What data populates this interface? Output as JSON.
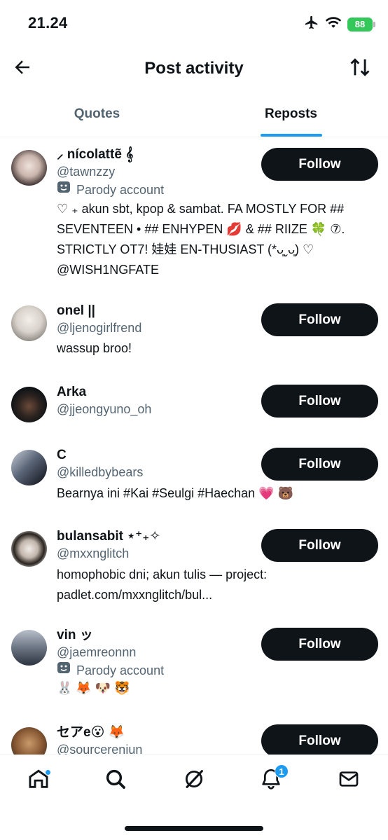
{
  "status_bar": {
    "time": "21.24",
    "battery": "88",
    "icons": [
      "airplane-icon",
      "wifi-icon",
      "battery-icon"
    ]
  },
  "header": {
    "title": "Post activity",
    "back_icon": "arrow-left-icon",
    "sort_icon": "sort-arrows-icon"
  },
  "tabs": [
    {
      "label": "Quotes",
      "active": false
    },
    {
      "label": "Reposts",
      "active": true
    }
  ],
  "users": [
    {
      "display_name": "⸝ nícolattẽ 𝄞",
      "handle": "@tawnzzy",
      "parody": "Parody account",
      "bio": "♡ ₊ akun sbt, kpop & sambat. FA MOSTLY FOR ## SEVENTEEN • ## ENHYPEN 💋 & ## RIIZE 🍀 ⑦. STRICTLY OT7! 娃娃 EN-THUSIAST (*ᴗ͈ˬᴗ͈) ♡ @WISH1NGFATE",
      "follow_label": "Follow"
    },
    {
      "display_name": "onel ||",
      "handle": "@ljenogirlfrend",
      "parody": "",
      "bio": "wassup broo!",
      "follow_label": "Follow"
    },
    {
      "display_name": "Arka",
      "handle": "@jjeongyuno_oh",
      "parody": "",
      "bio": "",
      "follow_label": "Follow"
    },
    {
      "display_name": "C",
      "handle": "@killedbybears",
      "parody": "",
      "bio": "Bearnya ini #Kai #Seulgi #Haechan 💗 🐻",
      "follow_label": "Follow"
    },
    {
      "display_name": "bulansabit ⋆⁺₊✧",
      "handle": "@mxxnglitch",
      "parody": "",
      "bio": "homophobic dni; akun tulis — project: padlet.com/mxxnglitch/bul...",
      "follow_label": "Follow"
    },
    {
      "display_name": "vin ッ",
      "handle": "@jaemreonnn",
      "parody": "Parody account",
      "bio": "🐰 🦊 🐶 🐯",
      "follow_label": "Follow"
    },
    {
      "display_name": "セアe😮 🦊",
      "handle": "@sourcereniun",
      "parody": "",
      "bio": "",
      "follow_label": "Follow"
    }
  ],
  "bottom_nav": {
    "items": [
      "home-icon",
      "search-icon",
      "grok-icon",
      "notifications-icon",
      "messages-icon"
    ],
    "notifications_badge": "1"
  },
  "colors": {
    "accent": "#1d9bf0",
    "button_bg": "#0f1419",
    "secondary_text": "#536471",
    "battery": "#34c759"
  }
}
